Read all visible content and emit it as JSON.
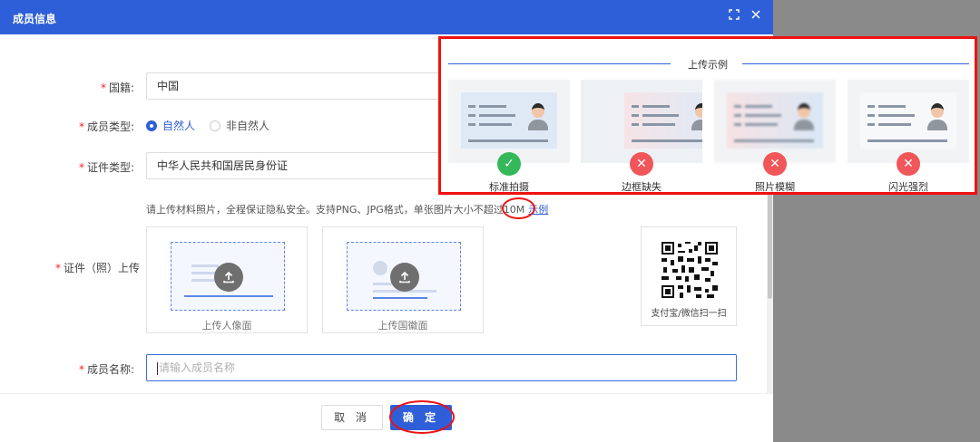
{
  "dialog": {
    "title": "成员信息",
    "expand_icon": "expand-icon",
    "close_icon": "close-icon"
  },
  "form": {
    "nationality": {
      "label": "国籍:",
      "value": "中国"
    },
    "member_type": {
      "label": "成员类型:",
      "options": [
        "自然人",
        "非自然人"
      ],
      "selected": "自然人"
    },
    "id_type": {
      "label": "证件类型:",
      "value": "中华人民共和国居民身份证"
    },
    "upload": {
      "hint": "请上传材料照片，全程保证隐私安全。支持PNG、JPG格式，单张图片大小不超过10M",
      "example_link": "示例",
      "label": "证件（照）上传",
      "front_caption": "上传人像面",
      "back_caption": "上传国徽面",
      "qr_caption": "支付宝/微信扫一扫"
    },
    "member_name": {
      "label": "成员名称:",
      "placeholder": "请输入成员名称",
      "value": ""
    }
  },
  "footer": {
    "cancel_label": "取 消",
    "ok_label": "确 定"
  },
  "example_popover": {
    "title": "上传示例",
    "items": [
      {
        "caption": "标准拍摄",
        "status": "ok"
      },
      {
        "caption": "边框缺失",
        "status": "bad"
      },
      {
        "caption": "照片模糊",
        "status": "bad"
      },
      {
        "caption": "闪光强烈",
        "status": "bad"
      }
    ]
  },
  "colors": {
    "primary": "#2f5fd8",
    "required": "#f5222d",
    "success": "#35b85a",
    "error": "#f0565a",
    "annotation_red": "#e11111"
  }
}
